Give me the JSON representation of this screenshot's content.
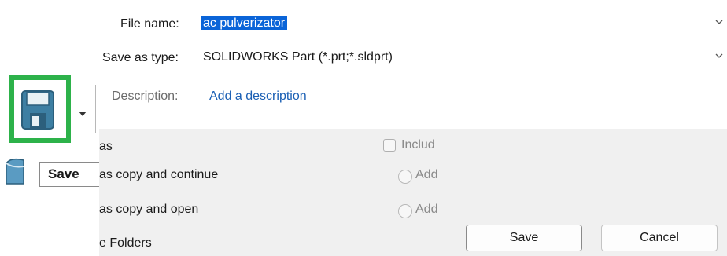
{
  "dialog": {
    "file_name_label": "File name:",
    "file_name_value": "ac pulverizator",
    "save_as_type_label": "Save as type:",
    "save_as_type_value": "SOLIDWORKS Part (*.prt;*.sldprt)",
    "description_label": "Description:",
    "description_link": "Add a description"
  },
  "options": {
    "save_as": "as",
    "save_as_copy_continue": "as copy and continue",
    "save_as_copy_open": "as copy and open",
    "include_label": "Includ",
    "add_label_1": "Add",
    "add_label_2": "Add",
    "folders": "e Folders"
  },
  "buttons": {
    "save": "Save",
    "cancel": "Cancel"
  },
  "toolbar": {
    "tooltip": "Save"
  },
  "colors": {
    "highlight_border": "#2db24a",
    "selection": "#0a64d8",
    "link": "#1a5fb4",
    "options_panel": "#f0f0f0"
  }
}
